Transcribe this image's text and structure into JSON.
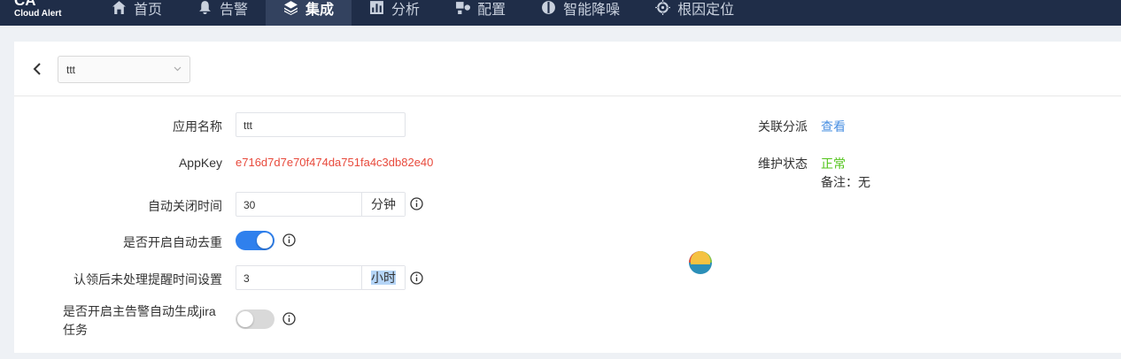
{
  "brand": {
    "short": "CA",
    "name": "Cloud Alert"
  },
  "nav": [
    {
      "label": "首页",
      "icon": "home-icon"
    },
    {
      "label": "告警",
      "icon": "bell-icon"
    },
    {
      "label": "集成",
      "icon": "layers-icon",
      "active": true
    },
    {
      "label": "分析",
      "icon": "chart-icon"
    },
    {
      "label": "配置",
      "icon": "settings-icon"
    },
    {
      "label": "智能降噪",
      "icon": "brain-icon"
    },
    {
      "label": "根因定位",
      "icon": "target-icon"
    }
  ],
  "selector": {
    "value": "ttt"
  },
  "form": {
    "app_name": {
      "label": "应用名称",
      "value": "ttt"
    },
    "appkey": {
      "label": "AppKey",
      "value": "e716d7d7e70f474da751fa4c3db82e40"
    },
    "auto_close": {
      "label": "自动关闭时间",
      "value": "30",
      "unit": "分钟"
    },
    "dedup": {
      "label": "是否开启自动去重",
      "on": true
    },
    "remind": {
      "label": "认领后未处理提醒时间设置",
      "value": "3",
      "unit": "小时"
    },
    "jira": {
      "label_line1": "是否开启主告警自动生成jira",
      "label_line2": "任务",
      "on": false
    }
  },
  "side": {
    "dispatch": {
      "label": "关联分派",
      "link": "查看"
    },
    "maintenance": {
      "label": "维护状态",
      "status": "正常",
      "remark_label": "备注：",
      "remark_value": "无"
    }
  },
  "colors": {
    "topbar": "#1f2d48",
    "active": "#33425f",
    "primary": "#2f80ed",
    "danger": "#e84a3c",
    "success": "#52c41a",
    "link": "#4a90e2"
  }
}
